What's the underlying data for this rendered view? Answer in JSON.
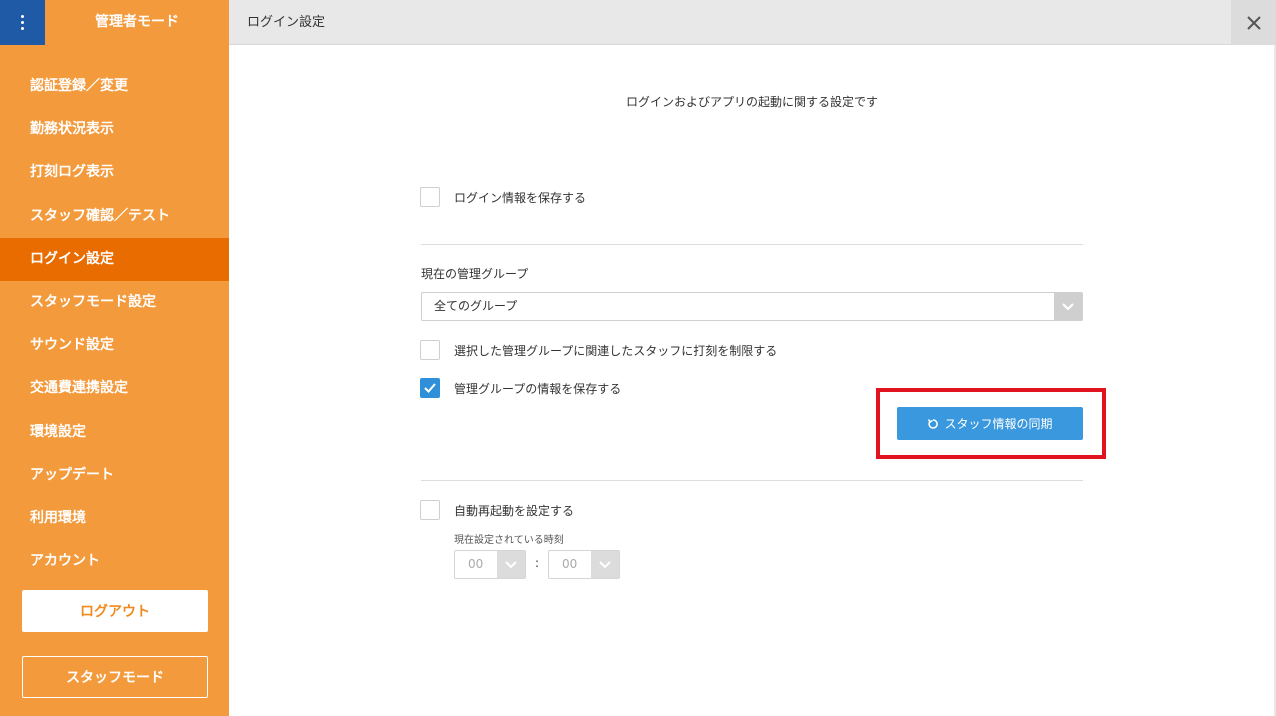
{
  "app": {
    "title": "管理者モード",
    "menu_icon": "vertical-dots-icon"
  },
  "sidebar": {
    "items": [
      {
        "label": "認証登録／変更"
      },
      {
        "label": "勤務状況表示"
      },
      {
        "label": "打刻ログ表示"
      },
      {
        "label": "スタッフ確認／テスト"
      },
      {
        "label": "ログイン設定",
        "active": true
      },
      {
        "label": "スタッフモード設定"
      },
      {
        "label": "サウンド設定"
      },
      {
        "label": "交通費連携設定"
      },
      {
        "label": "環境設定"
      },
      {
        "label": "アップデート"
      },
      {
        "label": "利用環境"
      },
      {
        "label": "アカウント"
      }
    ],
    "logout_label": "ログアウト",
    "staff_mode_label": "スタッフモード"
  },
  "header": {
    "title": "ログイン設定",
    "close_icon": "close-icon"
  },
  "content": {
    "description": "ログインおよびアプリの起動に関する設定です",
    "save_login": {
      "label": "ログイン情報を保存する",
      "checked": false
    },
    "group": {
      "label": "現在の管理グループ",
      "selected": "全てのグループ"
    },
    "restrict": {
      "label": "選択した管理グループに関連したスタッフに打刻を制限する",
      "checked": false
    },
    "save_group": {
      "label": "管理グループの情報を保存する",
      "checked": true
    },
    "sync_button": "スタッフ情報の同期",
    "auto_restart": {
      "label": "自動再起動を設定する",
      "checked": false
    },
    "time_label": "現在設定されている時刻",
    "hour": "00",
    "minute": "00",
    "colon": ":"
  },
  "colors": {
    "sidebar": "#f39a3c",
    "sidebar_active": "#e86c00",
    "menu_toggle": "#1f5aa6",
    "primary_button": "#3a98de",
    "highlight": "#e0131f"
  }
}
